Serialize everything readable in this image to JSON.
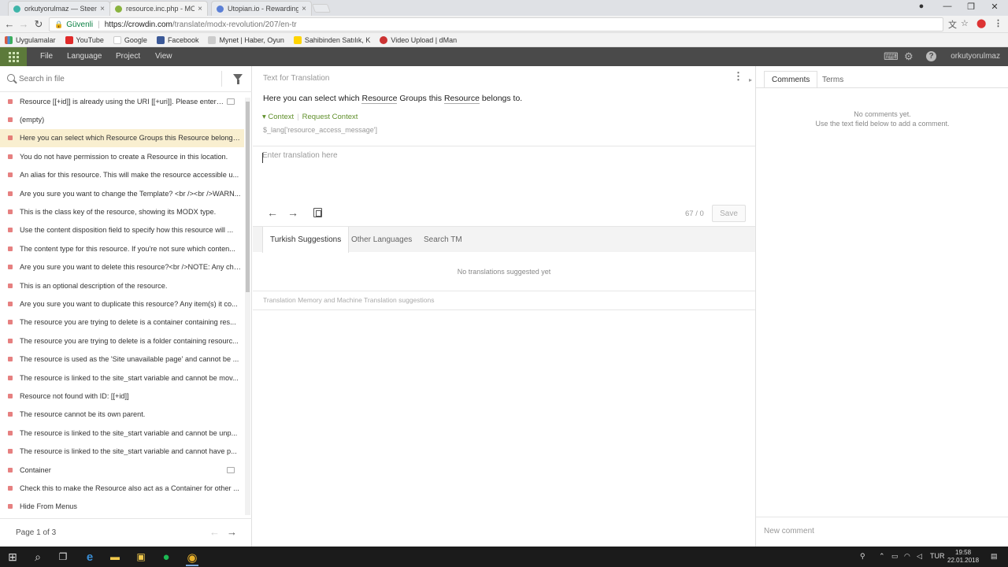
{
  "browser": {
    "tabs": [
      {
        "label": "orkutyorulmaz — Steem",
        "color": "#3fb5a9",
        "active": false
      },
      {
        "label": "resource.inc.php - MOD",
        "color": "#8ab33f",
        "active": true
      },
      {
        "label": "Utopian.io - Rewarding",
        "color": "#5a7fd6",
        "active": false
      }
    ],
    "tab_close": "×",
    "window": {
      "minimize": "—",
      "restore": "❐",
      "close": "✕",
      "profile": "●"
    },
    "nav": {
      "back": "←",
      "forward": "→",
      "reload": "↻"
    },
    "address": {
      "lock": "🔒",
      "secure_label": "Güvenli",
      "separator": "|",
      "host": "https://crowdin.com",
      "path": "/translate/modx-revolution/207/en-tr"
    },
    "right_icons": {
      "translate": "文",
      "star": "☆",
      "ext": "⬤",
      "menu": "⋮"
    },
    "bookmarks": [
      {
        "label": "Uygulamalar",
        "color": "#d95b43"
      },
      {
        "label": "YouTube",
        "color": "#e02a2a"
      },
      {
        "label": "Google",
        "color": "#ffffff"
      },
      {
        "label": "Facebook",
        "color": "#3b5998"
      },
      {
        "label": "Mynet | Haber, Oyun",
        "color": "#cccccc"
      },
      {
        "label": "Sahibinden Satılık, K",
        "color": "#ffd400"
      },
      {
        "label": "Video Upload | dMan",
        "color": "#cc3333"
      }
    ]
  },
  "app_header": {
    "menus": [
      "File",
      "Language",
      "Project",
      "View"
    ],
    "icons": {
      "keyboard": "⌨",
      "settings": "⚙",
      "help": "?"
    },
    "username": "orkutyorulmaz"
  },
  "left_panel": {
    "search_placeholder": "Search in file",
    "strings": [
      {
        "text": "Resource [[+id]] is already using the URI [[+uri]]. Please enter a ...",
        "comment": true,
        "selected": false
      },
      {
        "text": "(empty)",
        "comment": false,
        "selected": false
      },
      {
        "text": "Here you can select which Resource Groups this Resource belongs...",
        "comment": false,
        "selected": true
      },
      {
        "text": "You do not have permission to create a Resource in this location.",
        "comment": false,
        "selected": false
      },
      {
        "text": "An alias for this resource. This will make the resource accessible u...",
        "comment": false,
        "selected": false
      },
      {
        "text": "Are you sure you want to change the Template? <br /><br />WARN...",
        "comment": false,
        "selected": false
      },
      {
        "text": "This is the class key of the resource, showing its MODX type.",
        "comment": false,
        "selected": false
      },
      {
        "text": "Use the content disposition field to specify how this resource will ...",
        "comment": false,
        "selected": false
      },
      {
        "text": "The content type for this resource. If you're not sure which conten...",
        "comment": false,
        "selected": false
      },
      {
        "text": "Are you sure you want to delete this resource?<br />NOTE: Any chi...",
        "comment": false,
        "selected": false
      },
      {
        "text": "This is an optional description of the resource.",
        "comment": false,
        "selected": false
      },
      {
        "text": "Are you sure you want to duplicate this resource? Any item(s) it co...",
        "comment": false,
        "selected": false
      },
      {
        "text": "The resource you are trying to delete is a container containing res...",
        "comment": false,
        "selected": false
      },
      {
        "text": "The resource you are trying to delete is a folder containing resourc...",
        "comment": false,
        "selected": false
      },
      {
        "text": "The resource is used as the 'Site unavailable page' and cannot be ...",
        "comment": false,
        "selected": false
      },
      {
        "text": "The resource is linked to the site_start variable and cannot be mov...",
        "comment": false,
        "selected": false
      },
      {
        "text": "Resource not found with ID: [[+id]]",
        "comment": false,
        "selected": false
      },
      {
        "text": "The resource cannot be its own parent.",
        "comment": false,
        "selected": false
      },
      {
        "text": "The resource is linked to the site_start variable and cannot be unp...",
        "comment": false,
        "selected": false
      },
      {
        "text": "The resource is linked to the site_start variable and cannot have p...",
        "comment": false,
        "selected": false
      },
      {
        "text": "Container",
        "comment": true,
        "selected": false
      },
      {
        "text": "Check this to make the Resource also act as a Container for other ...",
        "comment": false,
        "selected": false
      },
      {
        "text": "Hide From Menus",
        "comment": false,
        "selected": false
      }
    ],
    "pager": {
      "label": "Page 1 of 3",
      "prev": "←",
      "next": "→"
    }
  },
  "center": {
    "header": "Text for Translation",
    "kebab": "⋮",
    "source_parts": {
      "a": "Here you can select which ",
      "b": "Resource",
      "c": " Groups this ",
      "d": "Resource",
      "e": " belongs to."
    },
    "context_label": "▾ Context",
    "context_sep": "|",
    "request_context": "Request Context",
    "key": "$_lang['resource_access_message']",
    "translation_placeholder": "Enter translation here",
    "arrows": {
      "prev": "←",
      "next": "→"
    },
    "counter": "67 / 0",
    "save_label": "Save",
    "suggestion_tabs": [
      "Turkish Suggestions",
      "Other Languages",
      "Search TM"
    ],
    "no_suggestions": "No translations suggested yet",
    "tm_note": "Translation Memory and Machine Translation suggestions",
    "collapse_left": "◂",
    "collapse_right": "▸"
  },
  "right_panel": {
    "tabs": [
      "Comments",
      "Terms"
    ],
    "no_comments_1": "No comments yet.",
    "no_comments_2": "Use the text field below to add a comment.",
    "new_comment_placeholder": "New comment"
  },
  "taskbar": {
    "start": "⊞",
    "search": "⌕",
    "taskview": "❐",
    "apps": [
      {
        "name": "edge",
        "glyph": "e",
        "color": "#3a8fd8"
      },
      {
        "name": "explorer",
        "glyph": "▬",
        "color": "#f2c94c"
      },
      {
        "name": "store",
        "glyph": "▣",
        "color": "#f2c94c"
      },
      {
        "name": "spotify",
        "glyph": "●",
        "color": "#1db954"
      },
      {
        "name": "chrome",
        "glyph": "◉",
        "color": "#e8b02a"
      }
    ],
    "tray": {
      "lang": "TUR",
      "time": "19:58",
      "date": "22.01.2018"
    }
  }
}
